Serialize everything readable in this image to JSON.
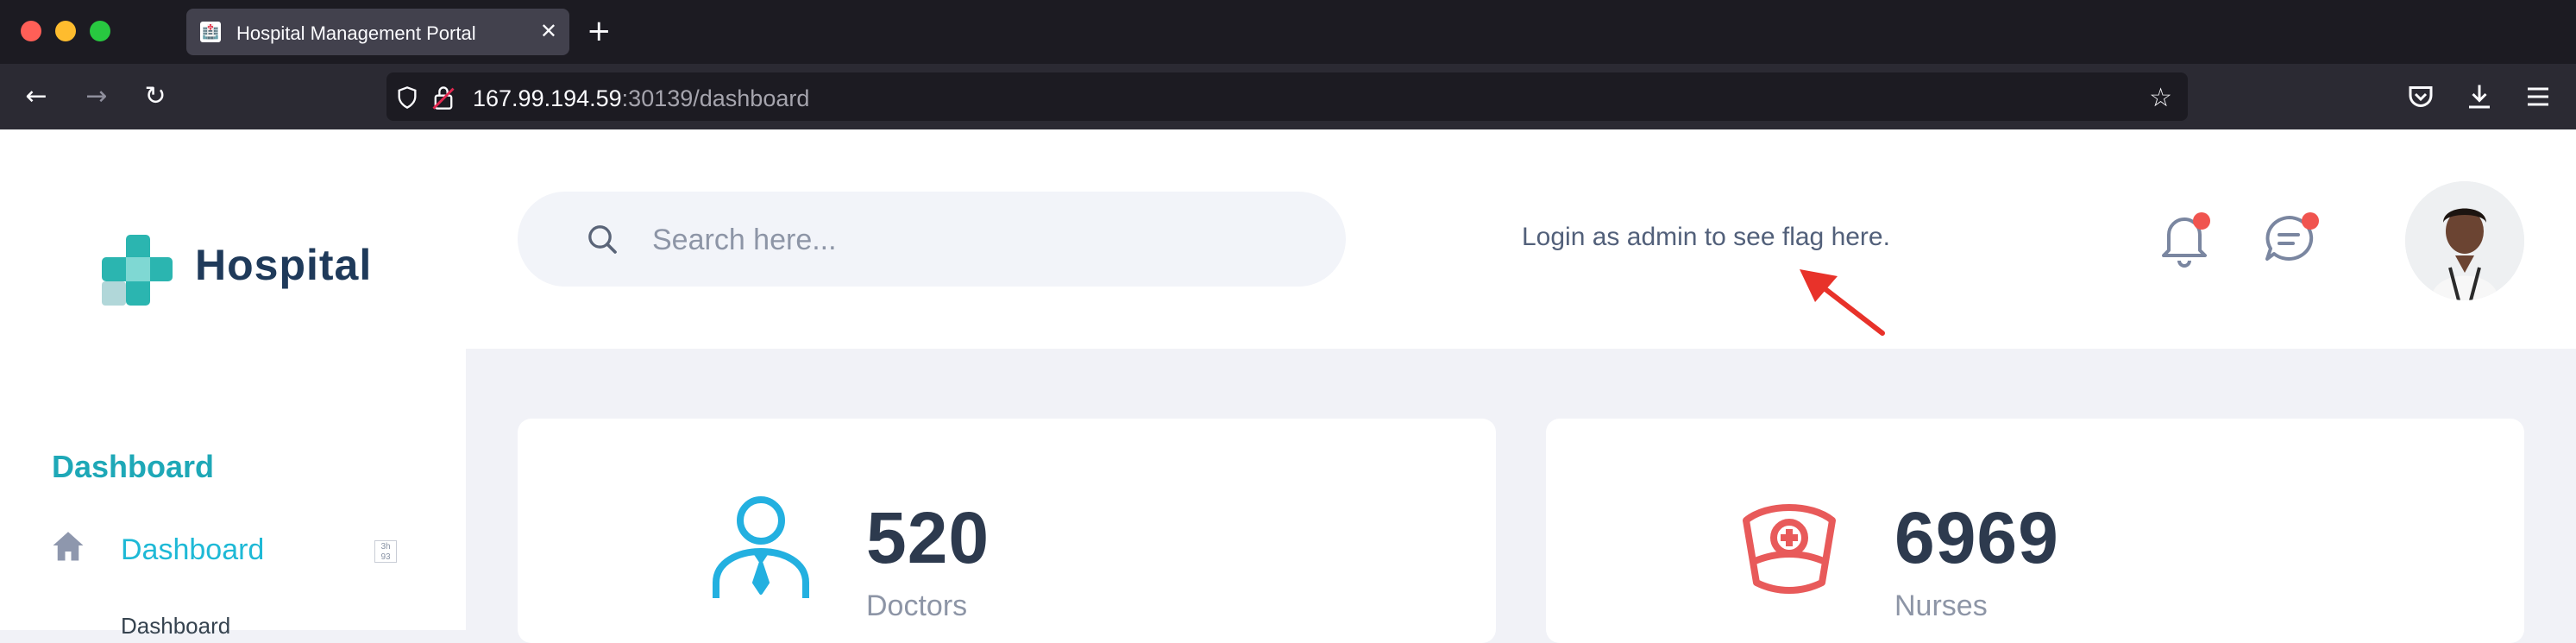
{
  "browser": {
    "tab_title": "Hospital Management Portal",
    "url_host": "167.99.194.59",
    "url_rest": ":30139/dashboard"
  },
  "sidebar": {
    "logo_text": "Hospital",
    "menu_heading": "Dashboard",
    "menu_item": "Dashboard",
    "menu_badge": "3h 93",
    "submenu_item": "Dashboard"
  },
  "header": {
    "search_placeholder": "Search here...",
    "flag_message": "Login as admin to see flag here."
  },
  "stats": [
    {
      "value": "520",
      "label": "Doctors"
    },
    {
      "value": "6969",
      "label": "Nurses"
    }
  ],
  "colors": {
    "accent": "#1eb9d6",
    "logo_teal": "#2bb5b0",
    "doctor_icon": "#23b0e0",
    "nurse_icon": "#e85a5a",
    "notification_dot": "#f0544f"
  }
}
